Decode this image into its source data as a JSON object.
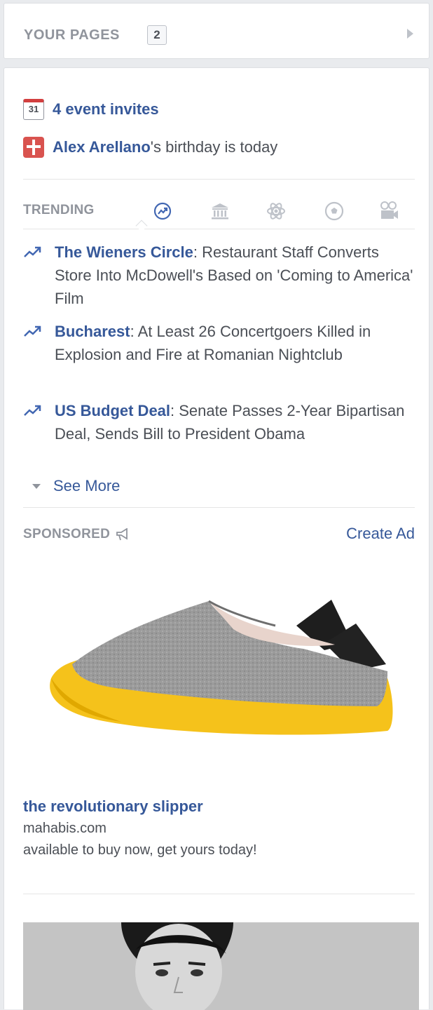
{
  "your_pages": {
    "label": "YOUR PAGES",
    "count": "2"
  },
  "reminders": {
    "events": {
      "calendar_day": "31",
      "text": "4 event invites"
    },
    "birthday": {
      "name": "Alex Arellano",
      "suffix": "'s birthday is today"
    }
  },
  "trending": {
    "label": "TRENDING",
    "tabs": [
      "trending-icon",
      "politics-icon",
      "science-icon",
      "sports-icon",
      "entertainment-icon"
    ],
    "items": [
      {
        "title": "The Wieners Circle",
        "desc": ": Restaurant Staff Converts Store Into McDowell's Based on 'Coming to America' Film"
      },
      {
        "title": "Bucharest",
        "desc": ": At Least 26 Concertgoers Killed in Explosion and Fire at Romanian Nightclub"
      },
      {
        "title": "US Budget Deal",
        "desc": ": Senate Passes 2-Year Bipartisan Deal, Sends Bill to President Obama"
      }
    ],
    "see_more": "See More"
  },
  "sponsored": {
    "label": "SPONSORED",
    "create_ad": "Create Ad",
    "ad": {
      "title": "the revolutionary slipper",
      "domain": "mahabis.com",
      "description": "available to buy now, get yours today!"
    }
  },
  "colors": {
    "link": "#365899",
    "muted": "#90949c",
    "slipper_sole": "#f5c21b",
    "slipper_felt": "#9a9a9a"
  }
}
